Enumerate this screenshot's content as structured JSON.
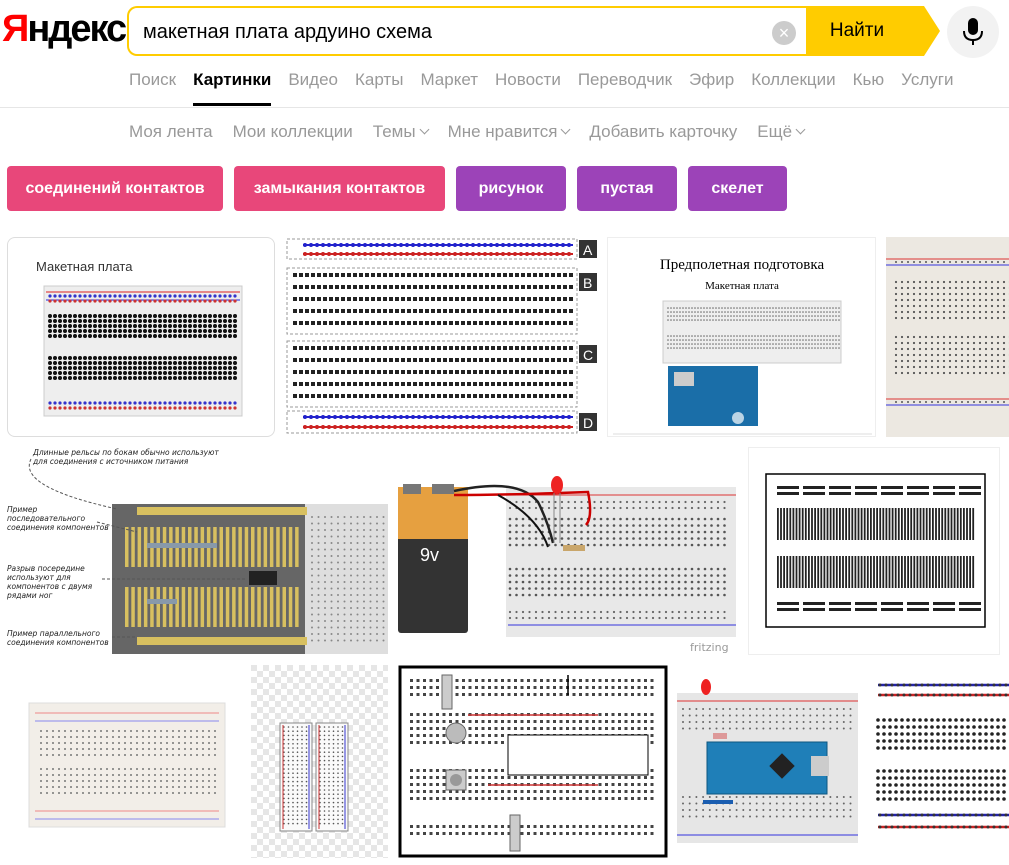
{
  "logo": {
    "first_letter": "Я",
    "rest": "ндекс"
  },
  "search": {
    "value": "макетная плата ардуино схема",
    "find_label": "Найти"
  },
  "nav": {
    "items": [
      "Поиск",
      "Картинки",
      "Видео",
      "Карты",
      "Маркет",
      "Новости",
      "Переводчик",
      "Эфир",
      "Коллекции",
      "Кью",
      "Услуги"
    ],
    "active": "Картинки"
  },
  "subnav": {
    "items": [
      "Моя лента",
      "Мои коллекции",
      "Темы",
      "Мне нравится",
      "Добавить карточку",
      "Ещё"
    ]
  },
  "chips": [
    {
      "label": "соединений контактов",
      "color": "#e8477a"
    },
    {
      "label": "замыкания контактов",
      "color": "#e8477a"
    },
    {
      "label": "рисунок",
      "color": "#9c43b8"
    },
    {
      "label": "пустая",
      "color": "#9c43b8"
    },
    {
      "label": "скелет",
      "color": "#9c43b8"
    }
  ],
  "images": {
    "img1_title": "Макетная плата",
    "img2_labels": [
      "A",
      "B",
      "C",
      "D"
    ],
    "img3_title": "Предполетная подготовка",
    "img3_subtitle": "Макетная плата",
    "img5_notes": [
      "Длинные рельсы по бокам обычно используют",
      "для соединения с источником питания",
      "Пример",
      "последовательного",
      "соединения компонентов",
      "Разрыв посередине",
      "используют для",
      "компонентов с двумя",
      "рядами ног",
      "Пример параллельного",
      "соединения компонентов"
    ],
    "img6_battery": "9v",
    "img6_watermark": "fritzing"
  }
}
